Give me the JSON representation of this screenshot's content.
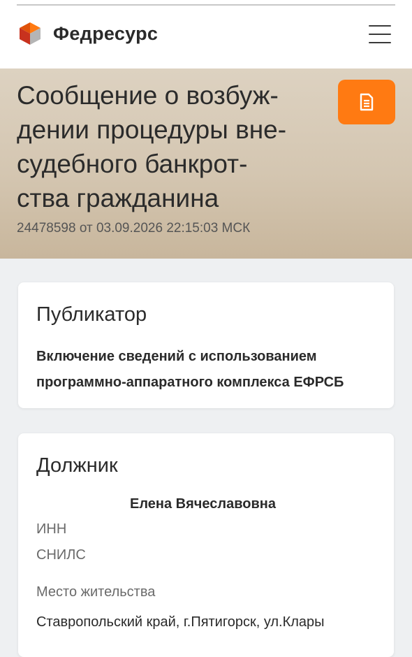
{
  "header": {
    "brand": "Федресурс",
    "logo_icon": "fedresurs-logo-icon",
    "menu_icon": "hamburger-menu-icon"
  },
  "hero": {
    "title": "Сообщение о возбуж-дении процедуры вне-судебного банкрот-ства гражданина",
    "title_lines": [
      "Сообщение о возбуж-",
      "дении процедуры вне-",
      "судебного банкрот-",
      "ства гражданина"
    ],
    "meta": "24478598 от 03.09.2026 22:15:03 МСК",
    "doc_icon": "document-icon",
    "accent": "#ff7a12"
  },
  "publisher": {
    "title": "Публикатор",
    "text": "Включение сведений с использованием программно-аппаратного комплекса ЕФРСБ"
  },
  "debtor": {
    "title": "Должник",
    "name": "Елена Вячеславовна",
    "inn_label": "ИНН",
    "snils_label": "СНИЛС",
    "residence_label": "Место жительства",
    "residence_value": "Ставропольский край, г.Пятигорск, ул.Клары"
  }
}
